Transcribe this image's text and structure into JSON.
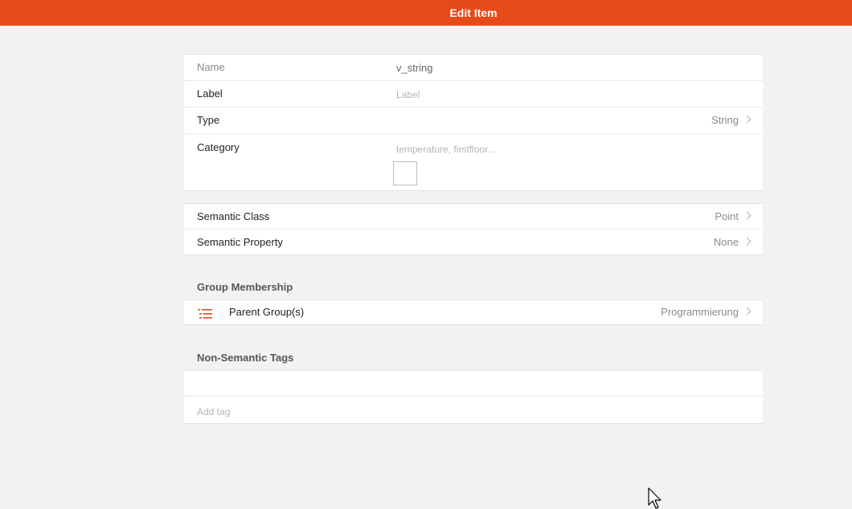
{
  "header": {
    "title": "Edit Item"
  },
  "basic": {
    "name_label": "Name",
    "name_value": "v_string",
    "label_label": "Label",
    "label_placeholder": "Label",
    "type_label": "Type",
    "type_value": "String",
    "category_label": "Category",
    "category_placeholder": "temperature, firstfloor..."
  },
  "semantic": {
    "class_label": "Semantic Class",
    "class_value": "Point",
    "property_label": "Semantic Property",
    "property_value": "None"
  },
  "group": {
    "title": "Group Membership",
    "parent_label": "Parent Group(s)",
    "parent_value": "Programmierung"
  },
  "tags": {
    "title": "Non-Semantic Tags",
    "add_placeholder": "Add tag"
  },
  "colors": {
    "accent": "#e64a19",
    "background": "#f2f2f2"
  }
}
